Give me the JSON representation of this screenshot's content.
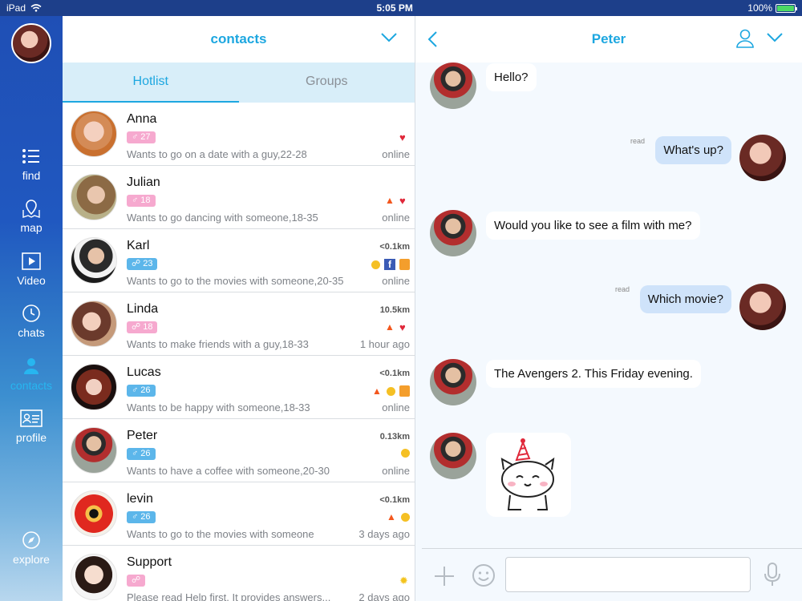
{
  "status_bar": {
    "device": "iPad",
    "time": "5:05 PM",
    "battery": "100%",
    "battery_level": 1.0
  },
  "sidebar": {
    "items": [
      {
        "label": "find",
        "icon": "list-icon"
      },
      {
        "label": "map",
        "icon": "map-icon"
      },
      {
        "label": "Video",
        "icon": "video-icon"
      },
      {
        "label": "chats",
        "icon": "clock-icon"
      },
      {
        "label": "contacts",
        "icon": "person-icon",
        "active": true
      },
      {
        "label": "profile",
        "icon": "id-card-icon"
      },
      {
        "label": "explore",
        "icon": "compass-icon"
      }
    ]
  },
  "contacts": {
    "title": "contacts",
    "tabs": [
      {
        "label": "Hotlist",
        "active": true
      },
      {
        "label": "Groups"
      }
    ],
    "list": [
      {
        "name": "Anna",
        "badge": "♂ 27",
        "badge_color": "pink",
        "status": "Wants to go on a date with a guy,22-28",
        "distance": "",
        "presence": "online",
        "icons": [
          "heart"
        ]
      },
      {
        "name": "Julian",
        "badge": "♂ 18",
        "badge_color": "pink",
        "status": "Wants to go dancing with someone,18-35",
        "distance": "",
        "presence": "online",
        "icons": [
          "fire",
          "heart"
        ]
      },
      {
        "name": "Karl",
        "badge": "☍ 23",
        "badge_color": "blue",
        "status": "Wants to go to the movies with someone,20-35",
        "distance": "<0.1km",
        "presence": "online",
        "icons": [
          "coin",
          "facebook",
          "app"
        ]
      },
      {
        "name": "Linda",
        "badge": "☍ 18",
        "badge_color": "pink",
        "status": "Wants to make friends with a guy,18-33",
        "distance": "10.5km",
        "presence": "1 hour ago",
        "icons": [
          "fire",
          "heart"
        ]
      },
      {
        "name": "Lucas",
        "badge": "♂ 26",
        "badge_color": "blue",
        "status": "Wants to be happy with someone,18-33",
        "distance": "<0.1km",
        "presence": "online",
        "icons": [
          "fire",
          "coin",
          "app"
        ]
      },
      {
        "name": "Peter",
        "badge": "♂ 26",
        "badge_color": "blue",
        "status": "Wants to have a coffee with someone,20-30",
        "distance": "0.13km",
        "presence": "online",
        "icons": [
          "coin"
        ]
      },
      {
        "name": "levin",
        "badge": "♂ 26",
        "badge_color": "blue",
        "status": "Wants to go to the movies with someone",
        "distance": "<0.1km",
        "presence": "3 days ago",
        "icons": [
          "fire",
          "coin"
        ]
      },
      {
        "name": "Support",
        "badge": "☍",
        "badge_color": "pink",
        "status": "Please read Help first. It provides answers...",
        "distance": "",
        "presence": "2 days ago",
        "icons": [
          "star"
        ]
      }
    ]
  },
  "chat": {
    "title": "Peter",
    "messages": [
      {
        "from": "them",
        "text": "Hello?"
      },
      {
        "from": "me",
        "text": "What's up?",
        "receipt": "read"
      },
      {
        "from": "them",
        "text": "Would you like to see a film with me?"
      },
      {
        "from": "me",
        "text": "Which movie?",
        "receipt": "read"
      },
      {
        "from": "them",
        "text": "The Avengers 2. This Friday evening."
      },
      {
        "from": "them",
        "sticker": "cat-sticker"
      }
    ],
    "input_placeholder": ""
  }
}
